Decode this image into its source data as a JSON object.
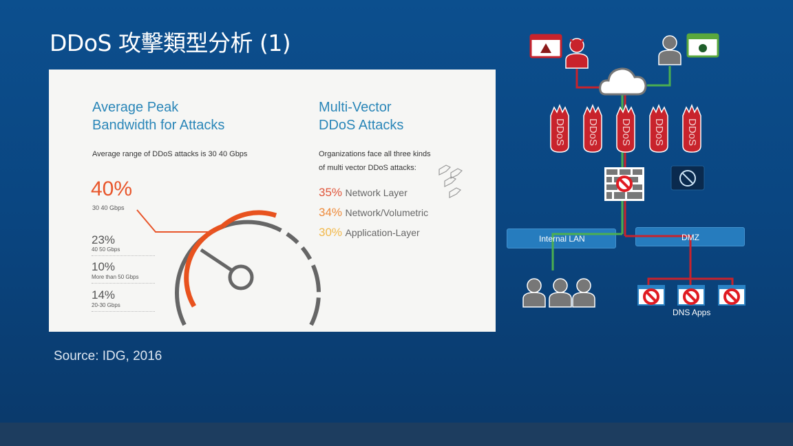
{
  "slide": {
    "title": "DDoS 攻擊類型分析 (1)",
    "source": "Source: IDG, 2016"
  },
  "infographic": {
    "left": {
      "heading_line1": "Average Peak",
      "heading_line2": "Bandwidth for Attacks",
      "subtitle": "Average range of DDoS attacks is 30 40 Gbps",
      "main_stat": {
        "value": "40%",
        "label": "30 40 Gbps"
      },
      "stats": [
        {
          "value": "23%",
          "label": "40 50 Gbps"
        },
        {
          "value": "10%",
          "label": "More than 50 Gbps"
        },
        {
          "value": "14%",
          "label": "20-30 Gbps"
        }
      ]
    },
    "right": {
      "heading_line1": "Multi-Vector",
      "heading_line2": "DDoS Attacks",
      "subtitle_line1": "Organizations face all three kinds",
      "subtitle_line2": "of multi vector DDoS attacks:",
      "items": [
        {
          "value": "35%",
          "label": "Network Layer",
          "color": "#e0553a"
        },
        {
          "value": "34%",
          "label": "Network/Volumetric",
          "color": "#ee8a3a"
        },
        {
          "value": "30%",
          "label": "Application-Layer",
          "color": "#f2b84a"
        }
      ]
    }
  },
  "diagram": {
    "bomb_label": "DDoS",
    "internal_lan": "Internal LAN",
    "dmz": "DMZ",
    "dns_apps": "DNS Apps",
    "colors": {
      "attack": "#c8232c",
      "legit": "#4caf50",
      "zone": "#2a83c5"
    }
  }
}
